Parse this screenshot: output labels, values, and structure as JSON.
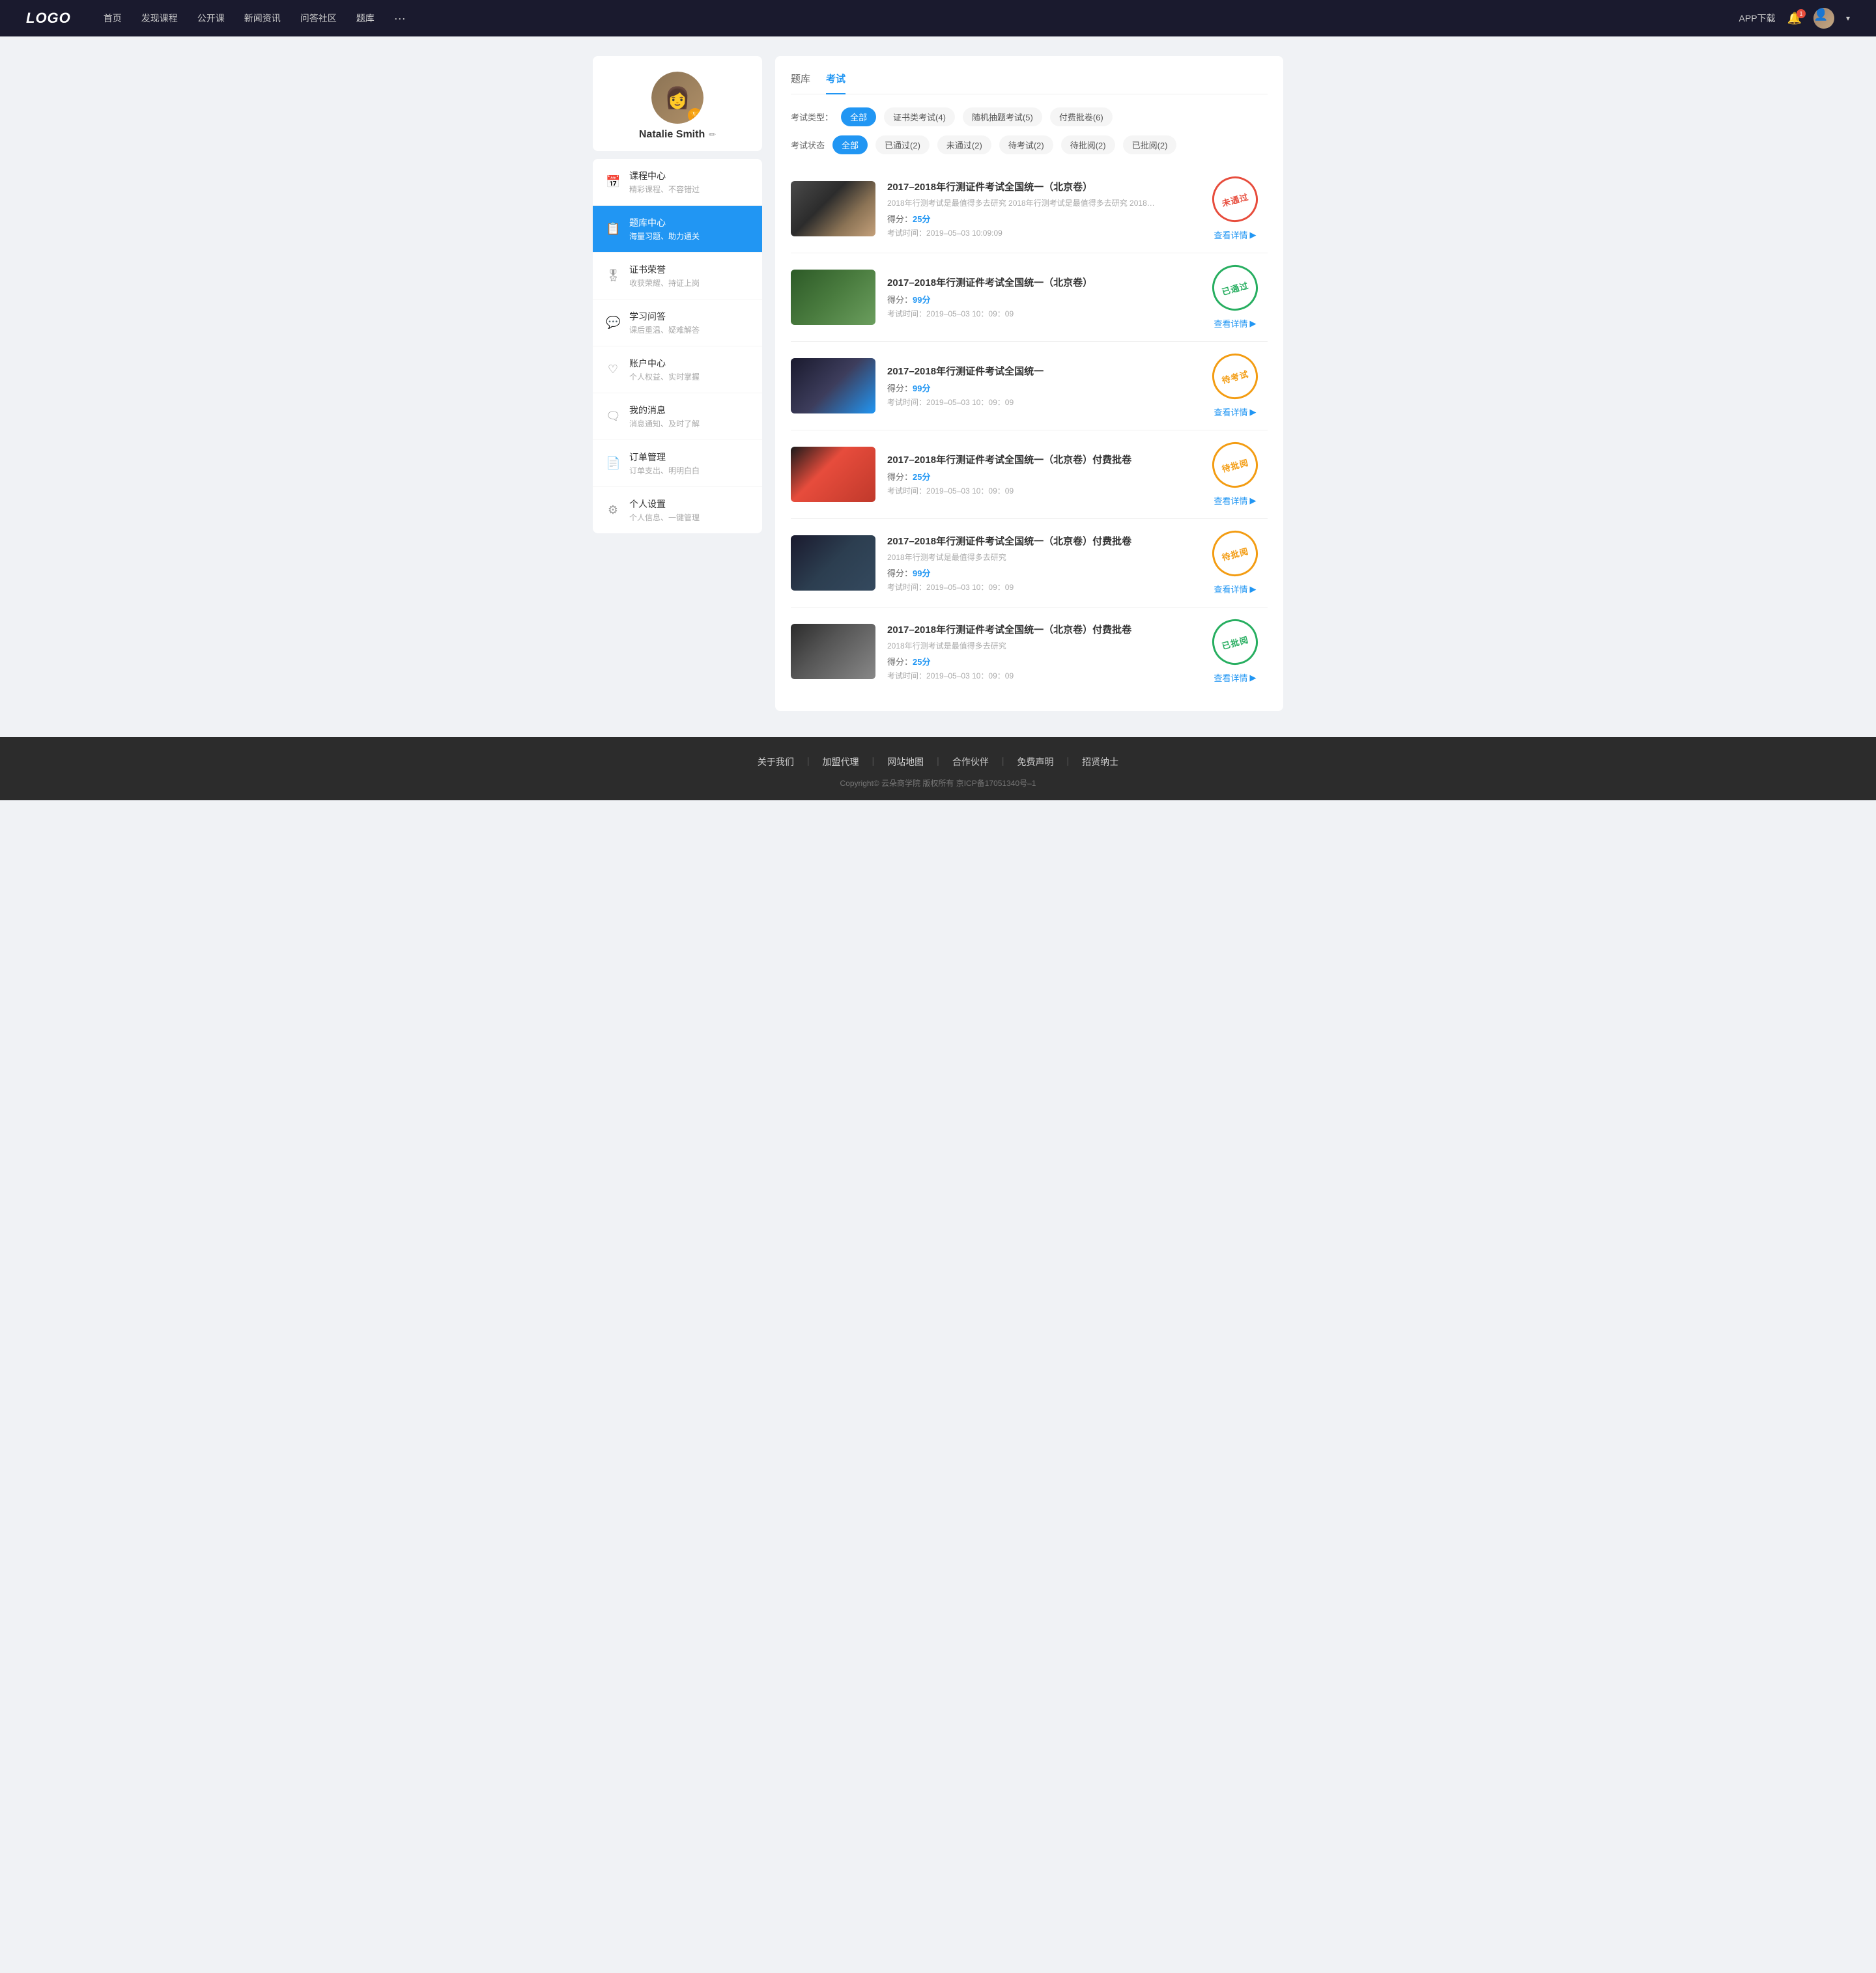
{
  "header": {
    "logo": "LOGO",
    "nav": [
      {
        "label": "首页",
        "id": "home"
      },
      {
        "label": "发现课程",
        "id": "discover"
      },
      {
        "label": "公开课",
        "id": "open"
      },
      {
        "label": "新闻资讯",
        "id": "news"
      },
      {
        "label": "问答社区",
        "id": "qa"
      },
      {
        "label": "题库",
        "id": "question-bank"
      }
    ],
    "nav_more": "···",
    "app_download": "APP下载",
    "bell_badge": "1",
    "dropdown_arrow": "▾"
  },
  "sidebar": {
    "profile": {
      "name": "Natalie Smith",
      "badge_icon": "🏆",
      "edit_icon": "✏"
    },
    "menu": [
      {
        "id": "course-center",
        "icon": "📅",
        "main": "课程中心",
        "sub": "精彩课程、不容错过",
        "active": false
      },
      {
        "id": "question-bank-center",
        "icon": "📋",
        "main": "题库中心",
        "sub": "海量习题、助力通关",
        "active": true
      },
      {
        "id": "certificate",
        "icon": "🎖",
        "main": "证书荣誉",
        "sub": "收获荣耀、持证上岗",
        "active": false
      },
      {
        "id": "study-qa",
        "icon": "💬",
        "main": "学习问答",
        "sub": "课后重温、疑难解答",
        "active": false
      },
      {
        "id": "account-center",
        "icon": "♡",
        "main": "账户中心",
        "sub": "个人权益、实时掌握",
        "active": false
      },
      {
        "id": "my-messages",
        "icon": "🗨",
        "main": "我的消息",
        "sub": "消息通知、及时了解",
        "active": false
      },
      {
        "id": "order-mgmt",
        "icon": "📄",
        "main": "订单管理",
        "sub": "订单支出、明明白白",
        "active": false
      },
      {
        "id": "settings",
        "icon": "⚙",
        "main": "个人设置",
        "sub": "个人信息、一键管理",
        "active": false
      }
    ]
  },
  "content": {
    "tabs": [
      {
        "label": "题库",
        "active": false
      },
      {
        "label": "考试",
        "active": true
      }
    ],
    "type_filter": {
      "label": "考试类型：",
      "options": [
        {
          "label": "全部",
          "active": true
        },
        {
          "label": "证书类考试(4)",
          "active": false
        },
        {
          "label": "随机抽题考试(5)",
          "active": false
        },
        {
          "label": "付费批卷(6)",
          "active": false
        }
      ]
    },
    "status_filter": {
      "label": "考试状态",
      "options": [
        {
          "label": "全部",
          "active": true
        },
        {
          "label": "已通过(2)",
          "active": false
        },
        {
          "label": "未通过(2)",
          "active": false
        },
        {
          "label": "待考试(2)",
          "active": false
        },
        {
          "label": "待批阅(2)",
          "active": false
        },
        {
          "label": "已批阅(2)",
          "active": false
        }
      ]
    },
    "exams": [
      {
        "id": 1,
        "title": "2017–2018年行测证件考试全国统一（北京卷）",
        "desc": "2018年行测考试是最值得多去研究 2018年行测考试是最值得多去研究 2018年行...",
        "score_label": "得分：",
        "score": "25分",
        "time_label": "考试时间：",
        "time": "2019–05–03  10:09:09",
        "status": "未通过",
        "status_type": "fail",
        "detail_label": "查看详情",
        "thumb_class": "thumb-1"
      },
      {
        "id": 2,
        "title": "2017–2018年行测证件考试全国统一（北京卷）",
        "desc": "",
        "score_label": "得分：",
        "score": "99分",
        "time_label": "考试时间：",
        "time": "2019–05–03  10：09：09",
        "status": "已通过",
        "status_type": "pass",
        "detail_label": "查看详情",
        "thumb_class": "thumb-2"
      },
      {
        "id": 3,
        "title": "2017–2018年行测证件考试全国统一",
        "desc": "",
        "score_label": "得分：",
        "score": "99分",
        "time_label": "考试时间：",
        "time": "2019–05–03  10：09：09",
        "status": "待考试",
        "status_type": "pending",
        "detail_label": "查看详情",
        "thumb_class": "thumb-3"
      },
      {
        "id": 4,
        "title": "2017–2018年行测证件考试全国统一（北京卷）付费批卷",
        "desc": "",
        "score_label": "得分：",
        "score": "25分",
        "time_label": "考试时间：",
        "time": "2019–05–03  10：09：09",
        "status": "待批阅",
        "status_type": "review",
        "detail_label": "查看详情",
        "thumb_class": "thumb-4"
      },
      {
        "id": 5,
        "title": "2017–2018年行测证件考试全国统一（北京卷）付费批卷",
        "desc": "2018年行测考试是最值得多去研究",
        "score_label": "得分：",
        "score": "99分",
        "time_label": "考试时间：",
        "time": "2019–05–03  10：09：09",
        "status": "待批阅",
        "status_type": "review",
        "detail_label": "查看详情",
        "thumb_class": "thumb-5"
      },
      {
        "id": 6,
        "title": "2017–2018年行测证件考试全国统一（北京卷）付费批卷",
        "desc": "2018年行测考试是最值得多去研究",
        "score_label": "得分：",
        "score": "25分",
        "time_label": "考试时间：",
        "time": "2019–05–03  10：09：09",
        "status": "已批阅",
        "status_type": "reviewed",
        "detail_label": "查看详情",
        "thumb_class": "thumb-6"
      }
    ]
  },
  "footer": {
    "links": [
      {
        "label": "关于我们"
      },
      {
        "label": "加盟代理"
      },
      {
        "label": "网站地图"
      },
      {
        "label": "合作伙伴"
      },
      {
        "label": "免费声明"
      },
      {
        "label": "招贤纳士"
      }
    ],
    "copyright": "Copyright© 云朵商学院  版权所有    京ICP备17051340号–1"
  }
}
